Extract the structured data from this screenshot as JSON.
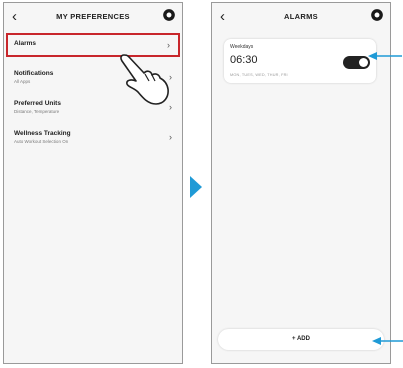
{
  "left_screen": {
    "title": "MY PREFERENCES",
    "back_icon": "back-chevron-icon",
    "settings_icon": "gear-icon",
    "items": [
      {
        "label": "Alarms",
        "subtitle": "",
        "highlighted": true
      },
      {
        "label": "Notifications",
        "subtitle": "All Apps"
      },
      {
        "label": "Preferred Units",
        "subtitle": "Distance, Temperature"
      },
      {
        "label": "Wellness Tracking",
        "subtitle": "Auto Workout Selection On"
      }
    ],
    "pointer_icon": "hand-pointer-icon"
  },
  "right_screen": {
    "title": "ALARMS",
    "back_icon": "back-chevron-icon",
    "settings_icon": "gear-icon",
    "alarm": {
      "label": "Weekdays",
      "time": "06:30",
      "days": "MON, TUES, WED, THUR, FRI",
      "enabled": true
    },
    "add_button_label": "+ ADD"
  },
  "colors": {
    "highlight": "#c8262b",
    "arrow": "#1f9ad6",
    "toggle_on": "#222222"
  }
}
